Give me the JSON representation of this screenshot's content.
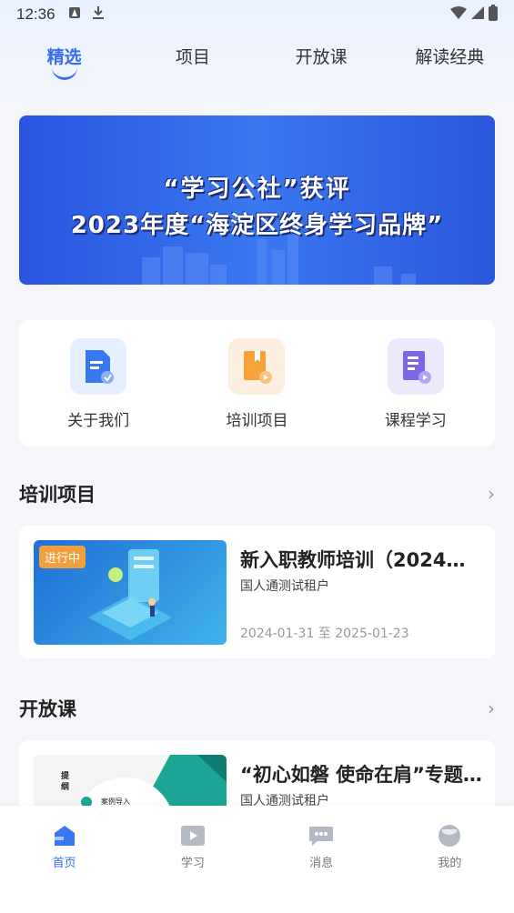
{
  "status_bar": {
    "time": "12:36"
  },
  "tabs": [
    {
      "label": "精选",
      "active": true
    },
    {
      "label": "项目",
      "active": false
    },
    {
      "label": "开放课",
      "active": false
    },
    {
      "label": "解读经典",
      "active": false
    }
  ],
  "banner": {
    "line1": "“学习公社”获评",
    "line2": "2023年度“海淀区终身学习品牌”"
  },
  "quick_links": [
    {
      "label": "关于我们",
      "icon": "document-icon"
    },
    {
      "label": "培训项目",
      "icon": "training-icon"
    },
    {
      "label": "课程学习",
      "icon": "course-icon"
    }
  ],
  "sections": {
    "training": {
      "title": "培训项目",
      "card": {
        "badge": "进行中",
        "title": "新入职教师培训（2024…",
        "org": "国人通测试租户",
        "date": "2024-01-31 至 2025-01-23"
      }
    },
    "open_course": {
      "title": "开放课",
      "card": {
        "title": "“初心如磐 使命在肩”专题…",
        "org": "国人通测试租户",
        "thumb_text_1": "提纲",
        "thumb_text_2": "案例导入"
      }
    }
  },
  "bottom_nav": [
    {
      "label": "首页",
      "active": true
    },
    {
      "label": "学习",
      "active": false
    },
    {
      "label": "消息",
      "active": false
    },
    {
      "label": "我的",
      "active": false
    }
  ],
  "colors": {
    "accent": "#3a6cf0",
    "badge": "#f0a03c"
  }
}
